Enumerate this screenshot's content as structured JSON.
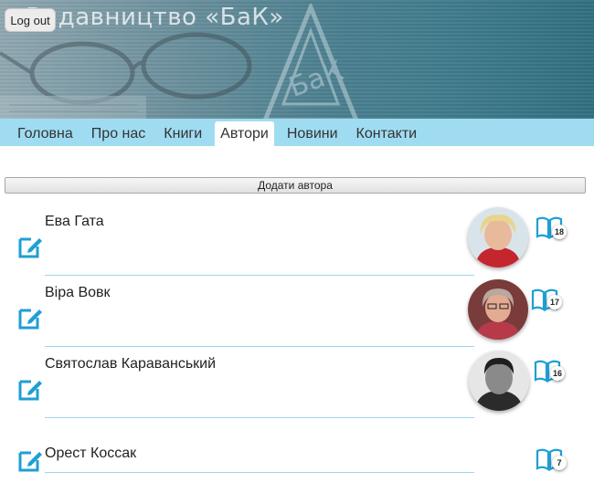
{
  "header": {
    "title": "Видавництво «БаК»",
    "logout_label": "Log out",
    "logo_text": "БаК"
  },
  "nav": {
    "items": [
      {
        "label": "Головна",
        "active": false
      },
      {
        "label": "Про нас",
        "active": false
      },
      {
        "label": "Книги",
        "active": false
      },
      {
        "label": "Автори",
        "active": true
      },
      {
        "label": "Новини",
        "active": false
      },
      {
        "label": "Контакти",
        "active": false
      }
    ]
  },
  "actions": {
    "add_author_label": "Додати автора"
  },
  "authors": [
    {
      "name": "Ева Гата",
      "books_count": "18",
      "has_photo": true
    },
    {
      "name": "Віра Вовк",
      "books_count": "17",
      "has_photo": true
    },
    {
      "name": "Святослав Караванський",
      "books_count": "16",
      "has_photo": true
    },
    {
      "name": "Орест Коссак",
      "books_count": "7",
      "has_photo": false
    }
  ],
  "colors": {
    "nav_bg": "#9fdcf2",
    "accent_icon": "#1e9fd4",
    "divider": "#9fd4ea"
  },
  "icons": {
    "edit": "edit-icon",
    "books": "open-book-icon"
  }
}
